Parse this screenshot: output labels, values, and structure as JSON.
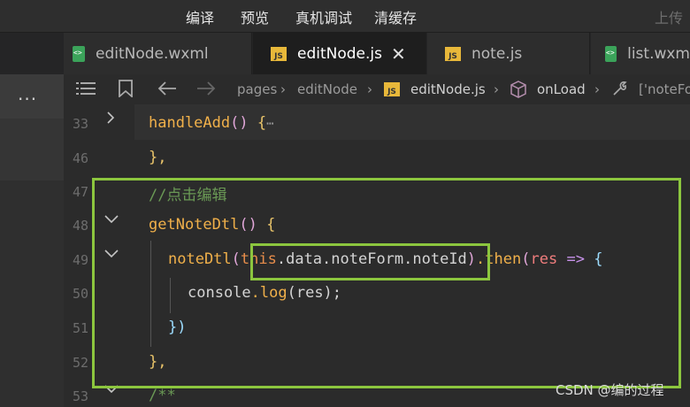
{
  "toolbar": {
    "items": [
      "编译",
      "预览",
      "真机调试",
      "清缓存"
    ],
    "upload": "上传"
  },
  "tabs": [
    {
      "label": "editNode.wxml",
      "icon": "wxml-file-icon"
    },
    {
      "label": "editNode.js",
      "icon": "js-file-icon"
    },
    {
      "label": "note.js",
      "icon": "js-file-icon"
    },
    {
      "label": "list.wxm",
      "icon": "wxml-file-icon"
    }
  ],
  "sidebar": {
    "more": "..."
  },
  "breadcrumb": {
    "pages": "pages",
    "folder": "editNode",
    "file": "editNode.js",
    "method": "onLoad",
    "last": "['noteFo"
  },
  "editor": {
    "line_numbers": [
      "33",
      "46",
      "47",
      "48",
      "49",
      "50",
      "51",
      "52",
      "53"
    ],
    "code": {
      "l33_name": "handleAdd",
      "l33_paren": "()",
      "l33_brace": "{",
      "l33_dots": "⋯",
      "l46": "},",
      "l47": "//点击编辑",
      "l48_name": "getNoteDtl",
      "l48_paren": "()",
      "l48_brace": "{",
      "l49_fn": "noteDtl",
      "l49_open": "(",
      "l49_this": "this",
      "l49_path": ".data.noteForm.noteId",
      "l49_close": ")",
      "l49_then": ".then",
      "l49_popen": "(",
      "l49_res": "res",
      "l49_arrow": "=>",
      "l49_brace": "{",
      "l50_console": "console",
      "l50_log": ".log",
      "l50_args": "(res);",
      "l51": "})",
      "l52": "},",
      "l53": "/**"
    }
  },
  "watermark": "CSDN @编的过程",
  "colors": {
    "highlight_box": "#8cc63e",
    "js_icon": "#e8b83a",
    "wxml_icon": "#3ba35a"
  }
}
